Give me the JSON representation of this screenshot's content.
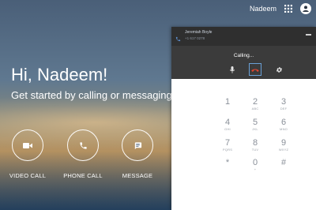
{
  "topbar": {
    "user_name": "Nadeem",
    "apps_icon": "apps-grid-icon",
    "avatar_icon": "account-avatar-icon"
  },
  "main": {
    "greeting": "Hi, Nadeem!",
    "subtitle": "Get started by calling or messaging a",
    "actions": [
      {
        "label": "VIDEO CALL",
        "icon": "video-camera-icon"
      },
      {
        "label": "PHONE CALL",
        "icon": "phone-icon"
      },
      {
        "label": "MESSAGE",
        "icon": "message-icon"
      }
    ]
  },
  "call_panel": {
    "contact_name": "Jeremiah Boyle",
    "contact_number": "+1 617 0278",
    "status": "Calling...",
    "controls": [
      {
        "name": "mute",
        "icon": "microphone-icon"
      },
      {
        "name": "hang-up",
        "icon": "hang-up-icon",
        "color": "#e0452f"
      },
      {
        "name": "settings",
        "icon": "gear-icon"
      }
    ],
    "dialpad": [
      {
        "digit": "1",
        "letters": ""
      },
      {
        "digit": "2",
        "letters": "ABC"
      },
      {
        "digit": "3",
        "letters": "DEF"
      },
      {
        "digit": "4",
        "letters": "GHI"
      },
      {
        "digit": "5",
        "letters": "JKL"
      },
      {
        "digit": "6",
        "letters": "MNO"
      },
      {
        "digit": "7",
        "letters": "PQRS"
      },
      {
        "digit": "8",
        "letters": "TUV"
      },
      {
        "digit": "9",
        "letters": "WXYZ"
      },
      {
        "digit": "*",
        "letters": ""
      },
      {
        "digit": "0",
        "letters": "+"
      },
      {
        "digit": "#",
        "letters": ""
      }
    ]
  },
  "colors": {
    "panel_header": "#3b3b3b",
    "hangup_red": "#e0452f",
    "dial_digit": "#8a9099"
  }
}
